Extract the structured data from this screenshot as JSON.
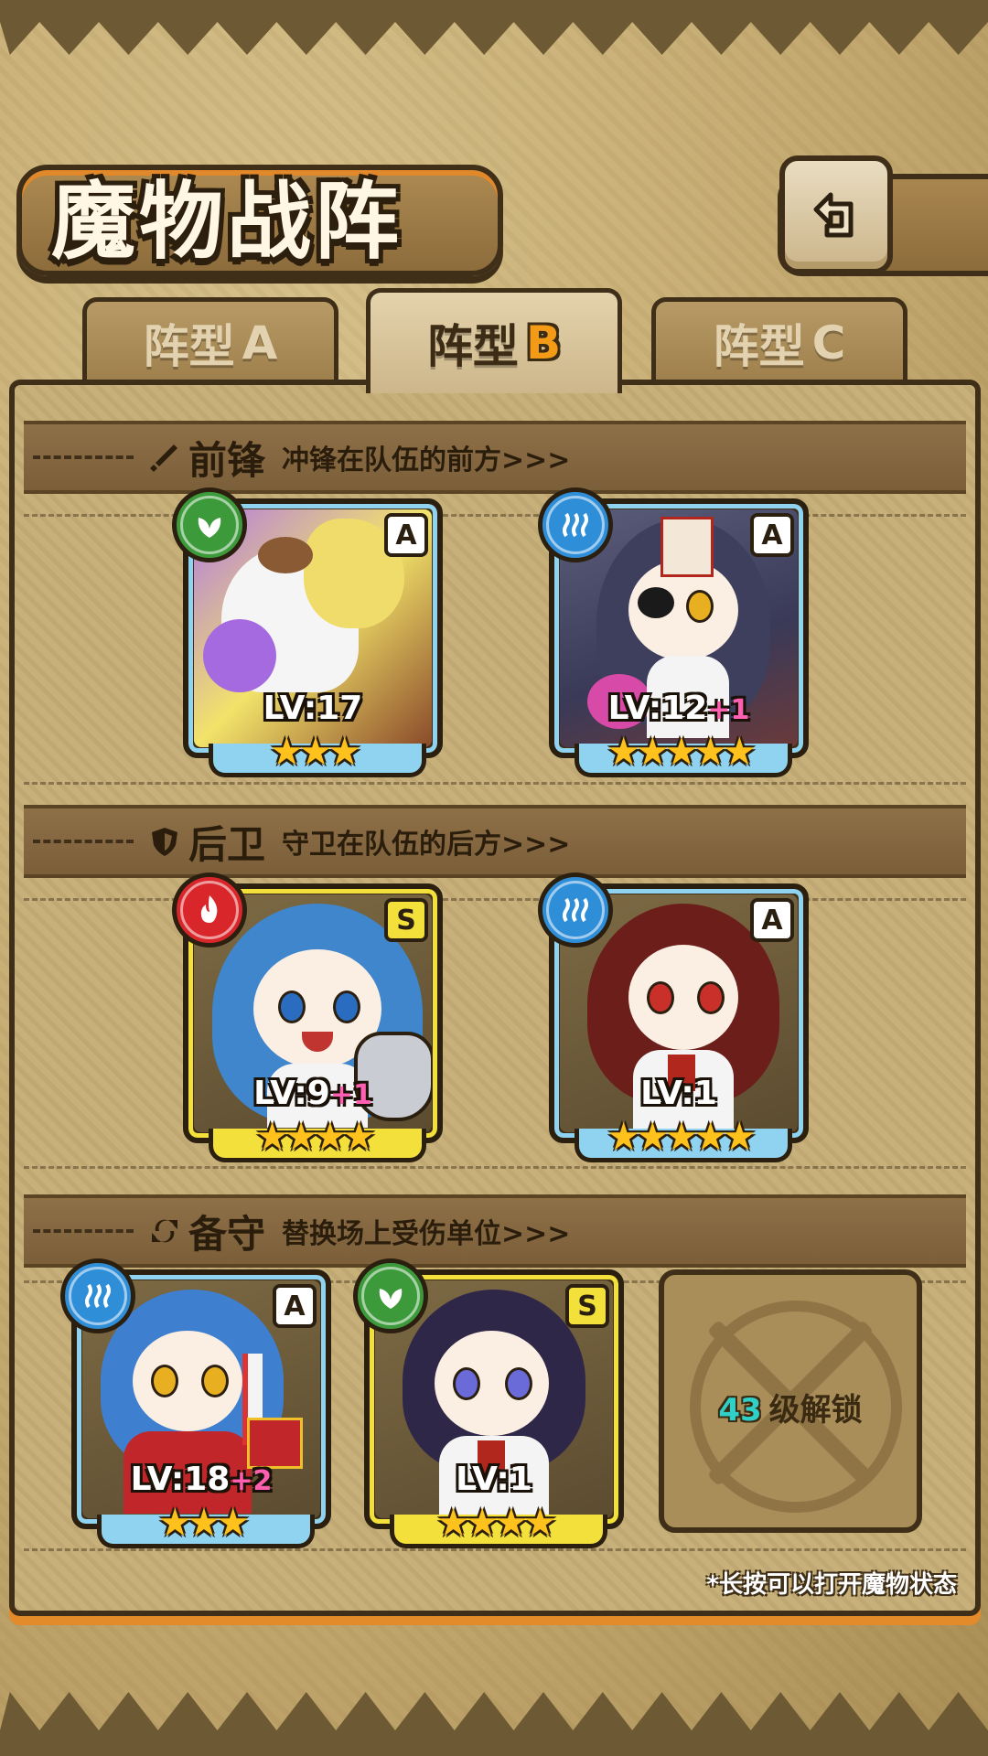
{
  "title": "魔物战阵",
  "tabs": [
    {
      "label": "阵型",
      "suffix": "A",
      "active": false
    },
    {
      "label": "阵型",
      "suffix": "B",
      "active": true
    },
    {
      "label": "阵型",
      "suffix": "C",
      "active": false
    }
  ],
  "sections": {
    "front": {
      "name": "前锋",
      "desc": "冲锋在队伍的前方>>>",
      "icon": "sword-icon"
    },
    "rear": {
      "name": "后卫",
      "desc": "守卫在队伍的后方>>>",
      "icon": "shield-icon"
    },
    "reserve": {
      "name": "备守",
      "desc": "替换场上受伤单位>>>",
      "icon": "swap-icon"
    }
  },
  "cards": [
    {
      "rank": "A",
      "element": "leaf",
      "level": "LV:17",
      "plus": "",
      "stars": 3
    },
    {
      "rank": "A",
      "element": "water",
      "level": "LV:12",
      "plus": "+1",
      "stars": 5
    },
    {
      "rank": "S",
      "element": "fire",
      "level": "LV:9",
      "plus": "+1",
      "stars": 4
    },
    {
      "rank": "A",
      "element": "water",
      "level": "LV:1",
      "plus": "",
      "stars": 5
    },
    {
      "rank": "A",
      "element": "water",
      "level": "LV:18",
      "plus": "+2",
      "stars": 3
    },
    {
      "rank": "S",
      "element": "leaf",
      "level": "LV:1",
      "plus": "",
      "stars": 4
    }
  ],
  "locked_slot": {
    "level": "43",
    "text": "级解锁"
  },
  "hint": "*长按可以打开魔物状态",
  "colors": {
    "rank_A": "#8fd3f0",
    "rank_S": "#f4e03a",
    "accent": "#f39a17"
  }
}
